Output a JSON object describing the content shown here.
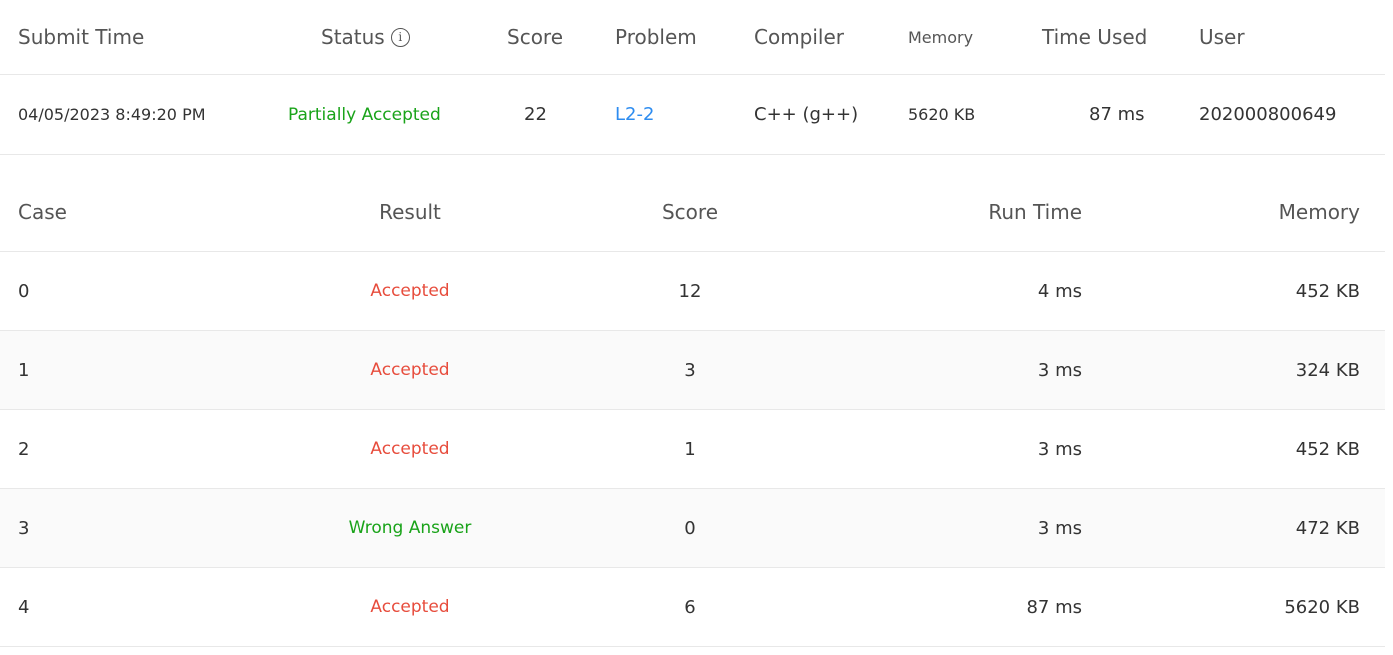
{
  "submission": {
    "headers": {
      "submit_time": "Submit Time",
      "status": "Status",
      "score": "Score",
      "problem": "Problem",
      "compiler": "Compiler",
      "memory": "Memory",
      "time_used": "Time Used",
      "user": "User"
    },
    "row": {
      "submit_time": "04/05/2023 8:49:20 PM",
      "status": "Partially Accepted",
      "score": "22",
      "problem": "L2-2",
      "compiler": "C++ (g++)",
      "memory": "5620 KB",
      "time_used": "87 ms",
      "user": "202000800649"
    },
    "status_info_icon": "info-icon"
  },
  "cases": {
    "headers": {
      "case": "Case",
      "result": "Result",
      "score": "Score",
      "run_time": "Run Time",
      "memory": "Memory"
    },
    "rows": [
      {
        "case": "0",
        "result": "Accepted",
        "score": "12",
        "run_time": "4 ms",
        "memory": "452 KB"
      },
      {
        "case": "1",
        "result": "Accepted",
        "score": "3",
        "run_time": "3 ms",
        "memory": "324 KB"
      },
      {
        "case": "2",
        "result": "Accepted",
        "score": "1",
        "run_time": "3 ms",
        "memory": "452 KB"
      },
      {
        "case": "3",
        "result": "Wrong Answer",
        "score": "0",
        "run_time": "3 ms",
        "memory": "472 KB"
      },
      {
        "case": "4",
        "result": "Accepted",
        "score": "6",
        "run_time": "87 ms",
        "memory": "5620 KB"
      }
    ]
  },
  "colors": {
    "accepted": "#e74c3c",
    "wrong_answer": "#19a319",
    "partially_accepted": "#19a319",
    "link": "#2d8cf0"
  }
}
